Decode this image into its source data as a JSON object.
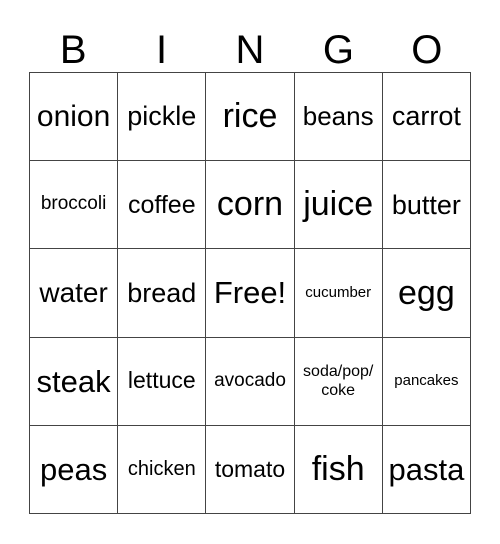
{
  "header": [
    "B",
    "I",
    "N",
    "G",
    "O"
  ],
  "cells": [
    [
      "onion",
      "pickle",
      "rice",
      "beans",
      "carrot"
    ],
    [
      "broccoli",
      "coffee",
      "corn",
      "juice",
      "butter"
    ],
    [
      "water",
      "bread",
      "Free!",
      "cucumber",
      "egg"
    ],
    [
      "steak",
      "lettuce",
      "avocado",
      "soda/pop/\ncoke",
      "pancakes"
    ],
    [
      "peas",
      "chicken",
      "tomato",
      "fish",
      "pasta"
    ]
  ]
}
